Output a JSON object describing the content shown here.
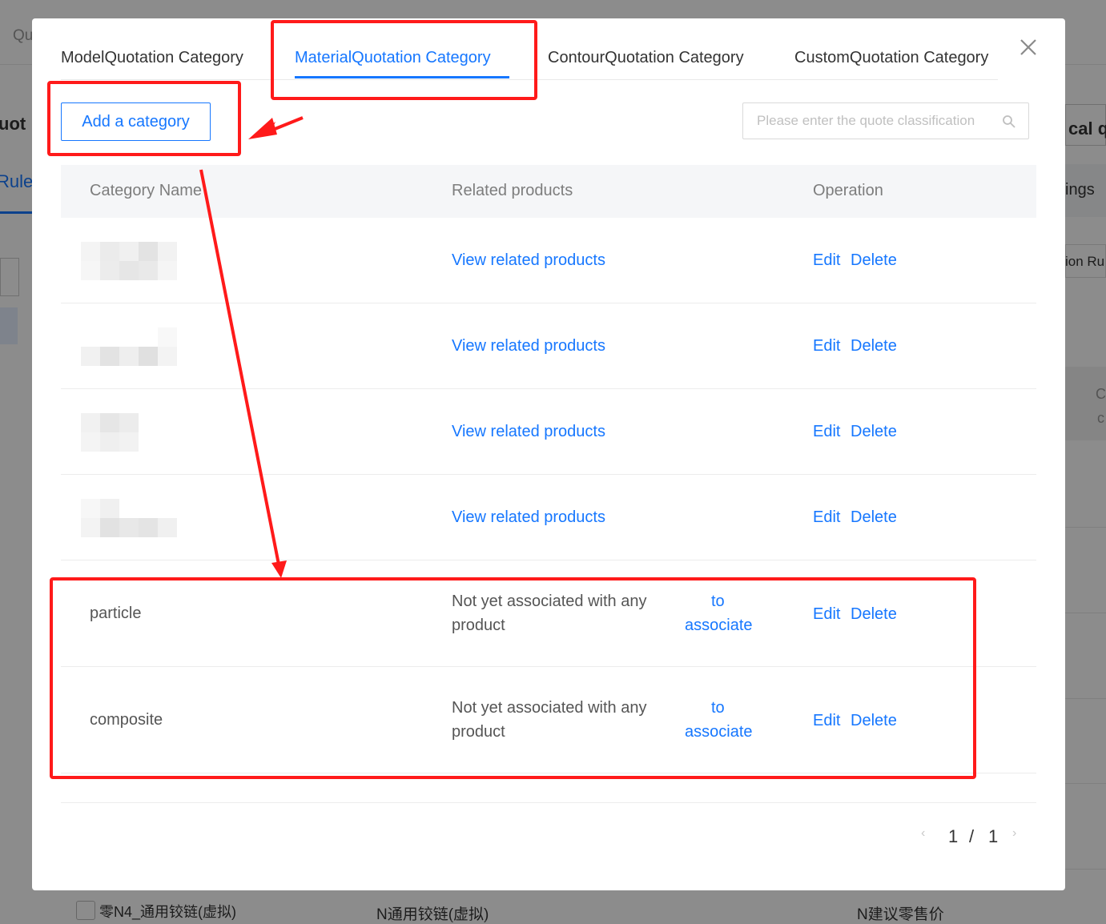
{
  "background": {
    "top_left": "Qu",
    "heading_left": "uot",
    "tab_left": "Rule",
    "right_heading": "cal qu",
    "right_tab": "ings",
    "right_item": "ion Ru",
    "right_c1": "C",
    "right_c2": "c",
    "row_name": "零N4_通用铰链(虚拟)",
    "row_product": "N通用铰链(虚拟)",
    "row_price": "N建议零售价"
  },
  "modal": {
    "tabs": [
      {
        "label": "ModelQuotation Category"
      },
      {
        "label": "MaterialQuotation Category",
        "active": true
      },
      {
        "label": "ContourQuotation Category"
      },
      {
        "label": "CustomQuotation Category"
      }
    ],
    "add_button": "Add a category",
    "search_placeholder": "Please enter the quote classification",
    "columns": [
      "Category Name",
      "Related products",
      "Operation"
    ],
    "rows": [
      {
        "name": "",
        "related": "View related products",
        "related_is_link": true,
        "edit": "Edit",
        "delete": "Delete"
      },
      {
        "name": "",
        "related": "View related products",
        "related_is_link": true,
        "edit": "Edit",
        "delete": "Delete"
      },
      {
        "name": "",
        "related": "View related products",
        "related_is_link": true,
        "edit": "Edit",
        "delete": "Delete"
      },
      {
        "name": "",
        "related": "View related products",
        "related_is_link": true,
        "edit": "Edit",
        "delete": "Delete"
      },
      {
        "name": "particle",
        "related_line1": "Not yet associated with any",
        "related_line2": "product",
        "associate_line1": "to",
        "associate_line2": "associate",
        "edit": "Edit",
        "delete": "Delete"
      },
      {
        "name": "composite",
        "related_line1": "Not yet associated with any",
        "related_line2": "product",
        "associate_line1": "to",
        "associate_line2": "associate",
        "edit": "Edit",
        "delete": "Delete"
      }
    ],
    "pagination": {
      "current": "1",
      "separator": "/",
      "total": "1"
    }
  },
  "colors": {
    "accent": "#1677ff",
    "annotation": "#ff1a1a"
  }
}
